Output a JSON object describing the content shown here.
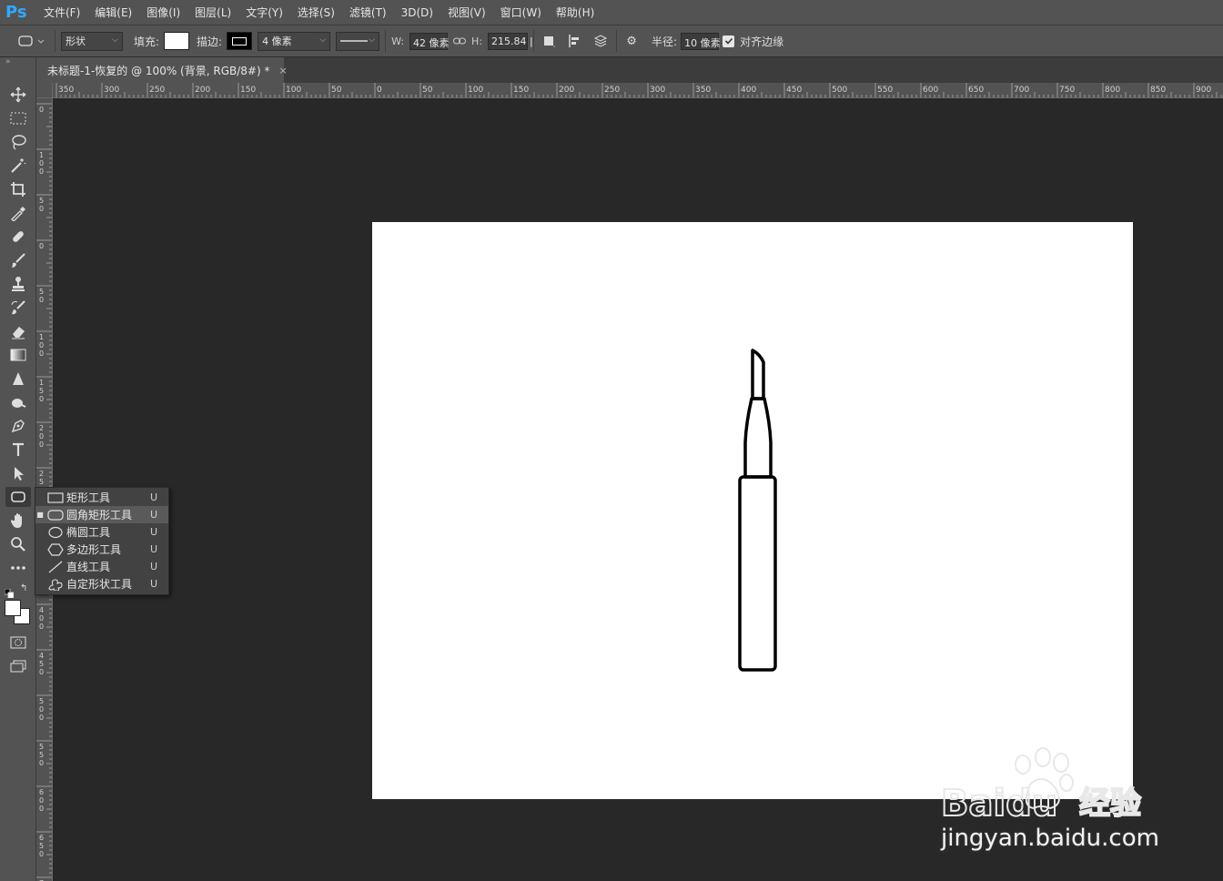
{
  "app": {
    "logo": "Ps"
  },
  "menu": [
    "文件(F)",
    "编辑(E)",
    "图像(I)",
    "图层(L)",
    "文字(Y)",
    "选择(S)",
    "滤镜(T)",
    "3D(D)",
    "视图(V)",
    "窗口(W)",
    "帮助(H)"
  ],
  "options": {
    "mode": "形状",
    "fill_label": "填充:",
    "stroke_label": "描边:",
    "stroke_width": "4 像素",
    "w_label": "W:",
    "w_value": "42 像素",
    "h_label": "H:",
    "h_value": "215.84 |",
    "radius_label": "半径:",
    "radius_value": "10 像素",
    "align_edges_label": "对齐边缘",
    "align_edges_checked": true
  },
  "document": {
    "tab_title": "未标题-1-恢复的 @ 100% (背景, RGB/8#) *",
    "close": "×"
  },
  "ruler_h": [
    "350",
    "300",
    "250",
    "200",
    "150",
    "100",
    "50",
    "0",
    "50",
    "100",
    "150",
    "200",
    "250",
    "300",
    "350",
    "400",
    "450",
    "500",
    "550",
    "600",
    "650",
    "700",
    "750",
    "800",
    "850",
    "900"
  ],
  "ruler_v": [
    "0",
    "100",
    "50",
    "0",
    "50",
    "100",
    "150",
    "200",
    "250",
    "300",
    "350",
    "400",
    "450",
    "500",
    "550",
    "600",
    "650",
    "700"
  ],
  "flyout": [
    {
      "label": "矩形工具",
      "key": "U",
      "icon": "rectangle-icon",
      "selected": false
    },
    {
      "label": "圆角矩形工具",
      "key": "U",
      "icon": "rounded-rectangle-icon",
      "selected": true
    },
    {
      "label": "椭圆工具",
      "key": "U",
      "icon": "ellipse-icon",
      "selected": false
    },
    {
      "label": "多边形工具",
      "key": "U",
      "icon": "polygon-icon",
      "selected": false
    },
    {
      "label": "直线工具",
      "key": "U",
      "icon": "line-icon",
      "selected": false
    },
    {
      "label": "自定形状工具",
      "key": "U",
      "icon": "custom-shape-icon",
      "selected": false
    }
  ],
  "watermark": {
    "text": "jingyan.baidu.com",
    "brand": "Baidu",
    "brand_suffix": "经验"
  },
  "colors": {
    "ui_bg": "#535353",
    "canvas_bg": "#282828",
    "document": "#ffffff",
    "ps_blue": "#31a8ff"
  }
}
